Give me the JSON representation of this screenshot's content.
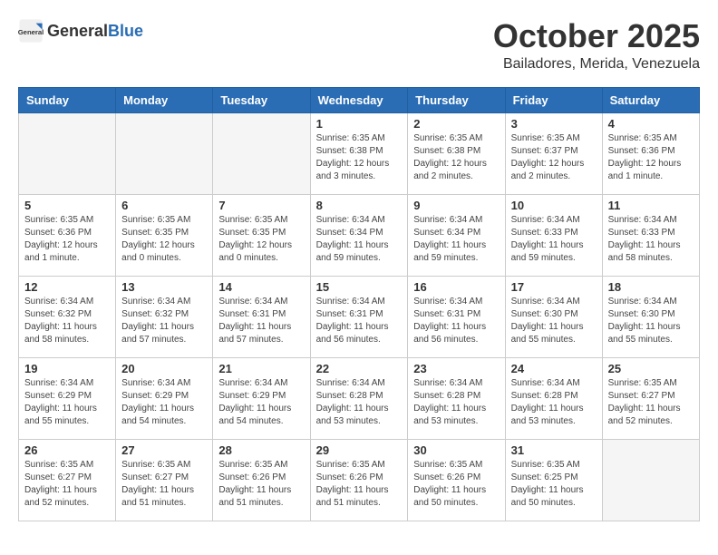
{
  "header": {
    "logo_general": "General",
    "logo_blue": "Blue",
    "month_year": "October 2025",
    "location": "Bailadores, Merida, Venezuela"
  },
  "weekdays": [
    "Sunday",
    "Monday",
    "Tuesday",
    "Wednesday",
    "Thursday",
    "Friday",
    "Saturday"
  ],
  "weeks": [
    [
      {
        "day": "",
        "info": ""
      },
      {
        "day": "",
        "info": ""
      },
      {
        "day": "",
        "info": ""
      },
      {
        "day": "1",
        "info": "Sunrise: 6:35 AM\nSunset: 6:38 PM\nDaylight: 12 hours\nand 3 minutes."
      },
      {
        "day": "2",
        "info": "Sunrise: 6:35 AM\nSunset: 6:38 PM\nDaylight: 12 hours\nand 2 minutes."
      },
      {
        "day": "3",
        "info": "Sunrise: 6:35 AM\nSunset: 6:37 PM\nDaylight: 12 hours\nand 2 minutes."
      },
      {
        "day": "4",
        "info": "Sunrise: 6:35 AM\nSunset: 6:36 PM\nDaylight: 12 hours\nand 1 minute."
      }
    ],
    [
      {
        "day": "5",
        "info": "Sunrise: 6:35 AM\nSunset: 6:36 PM\nDaylight: 12 hours\nand 1 minute."
      },
      {
        "day": "6",
        "info": "Sunrise: 6:35 AM\nSunset: 6:35 PM\nDaylight: 12 hours\nand 0 minutes."
      },
      {
        "day": "7",
        "info": "Sunrise: 6:35 AM\nSunset: 6:35 PM\nDaylight: 12 hours\nand 0 minutes."
      },
      {
        "day": "8",
        "info": "Sunrise: 6:34 AM\nSunset: 6:34 PM\nDaylight: 11 hours\nand 59 minutes."
      },
      {
        "day": "9",
        "info": "Sunrise: 6:34 AM\nSunset: 6:34 PM\nDaylight: 11 hours\nand 59 minutes."
      },
      {
        "day": "10",
        "info": "Sunrise: 6:34 AM\nSunset: 6:33 PM\nDaylight: 11 hours\nand 59 minutes."
      },
      {
        "day": "11",
        "info": "Sunrise: 6:34 AM\nSunset: 6:33 PM\nDaylight: 11 hours\nand 58 minutes."
      }
    ],
    [
      {
        "day": "12",
        "info": "Sunrise: 6:34 AM\nSunset: 6:32 PM\nDaylight: 11 hours\nand 58 minutes."
      },
      {
        "day": "13",
        "info": "Sunrise: 6:34 AM\nSunset: 6:32 PM\nDaylight: 11 hours\nand 57 minutes."
      },
      {
        "day": "14",
        "info": "Sunrise: 6:34 AM\nSunset: 6:31 PM\nDaylight: 11 hours\nand 57 minutes."
      },
      {
        "day": "15",
        "info": "Sunrise: 6:34 AM\nSunset: 6:31 PM\nDaylight: 11 hours\nand 56 minutes."
      },
      {
        "day": "16",
        "info": "Sunrise: 6:34 AM\nSunset: 6:31 PM\nDaylight: 11 hours\nand 56 minutes."
      },
      {
        "day": "17",
        "info": "Sunrise: 6:34 AM\nSunset: 6:30 PM\nDaylight: 11 hours\nand 55 minutes."
      },
      {
        "day": "18",
        "info": "Sunrise: 6:34 AM\nSunset: 6:30 PM\nDaylight: 11 hours\nand 55 minutes."
      }
    ],
    [
      {
        "day": "19",
        "info": "Sunrise: 6:34 AM\nSunset: 6:29 PM\nDaylight: 11 hours\nand 55 minutes."
      },
      {
        "day": "20",
        "info": "Sunrise: 6:34 AM\nSunset: 6:29 PM\nDaylight: 11 hours\nand 54 minutes."
      },
      {
        "day": "21",
        "info": "Sunrise: 6:34 AM\nSunset: 6:29 PM\nDaylight: 11 hours\nand 54 minutes."
      },
      {
        "day": "22",
        "info": "Sunrise: 6:34 AM\nSunset: 6:28 PM\nDaylight: 11 hours\nand 53 minutes."
      },
      {
        "day": "23",
        "info": "Sunrise: 6:34 AM\nSunset: 6:28 PM\nDaylight: 11 hours\nand 53 minutes."
      },
      {
        "day": "24",
        "info": "Sunrise: 6:34 AM\nSunset: 6:28 PM\nDaylight: 11 hours\nand 53 minutes."
      },
      {
        "day": "25",
        "info": "Sunrise: 6:35 AM\nSunset: 6:27 PM\nDaylight: 11 hours\nand 52 minutes."
      }
    ],
    [
      {
        "day": "26",
        "info": "Sunrise: 6:35 AM\nSunset: 6:27 PM\nDaylight: 11 hours\nand 52 minutes."
      },
      {
        "day": "27",
        "info": "Sunrise: 6:35 AM\nSunset: 6:27 PM\nDaylight: 11 hours\nand 51 minutes."
      },
      {
        "day": "28",
        "info": "Sunrise: 6:35 AM\nSunset: 6:26 PM\nDaylight: 11 hours\nand 51 minutes."
      },
      {
        "day": "29",
        "info": "Sunrise: 6:35 AM\nSunset: 6:26 PM\nDaylight: 11 hours\nand 51 minutes."
      },
      {
        "day": "30",
        "info": "Sunrise: 6:35 AM\nSunset: 6:26 PM\nDaylight: 11 hours\nand 50 minutes."
      },
      {
        "day": "31",
        "info": "Sunrise: 6:35 AM\nSunset: 6:25 PM\nDaylight: 11 hours\nand 50 minutes."
      },
      {
        "day": "",
        "info": ""
      }
    ]
  ]
}
